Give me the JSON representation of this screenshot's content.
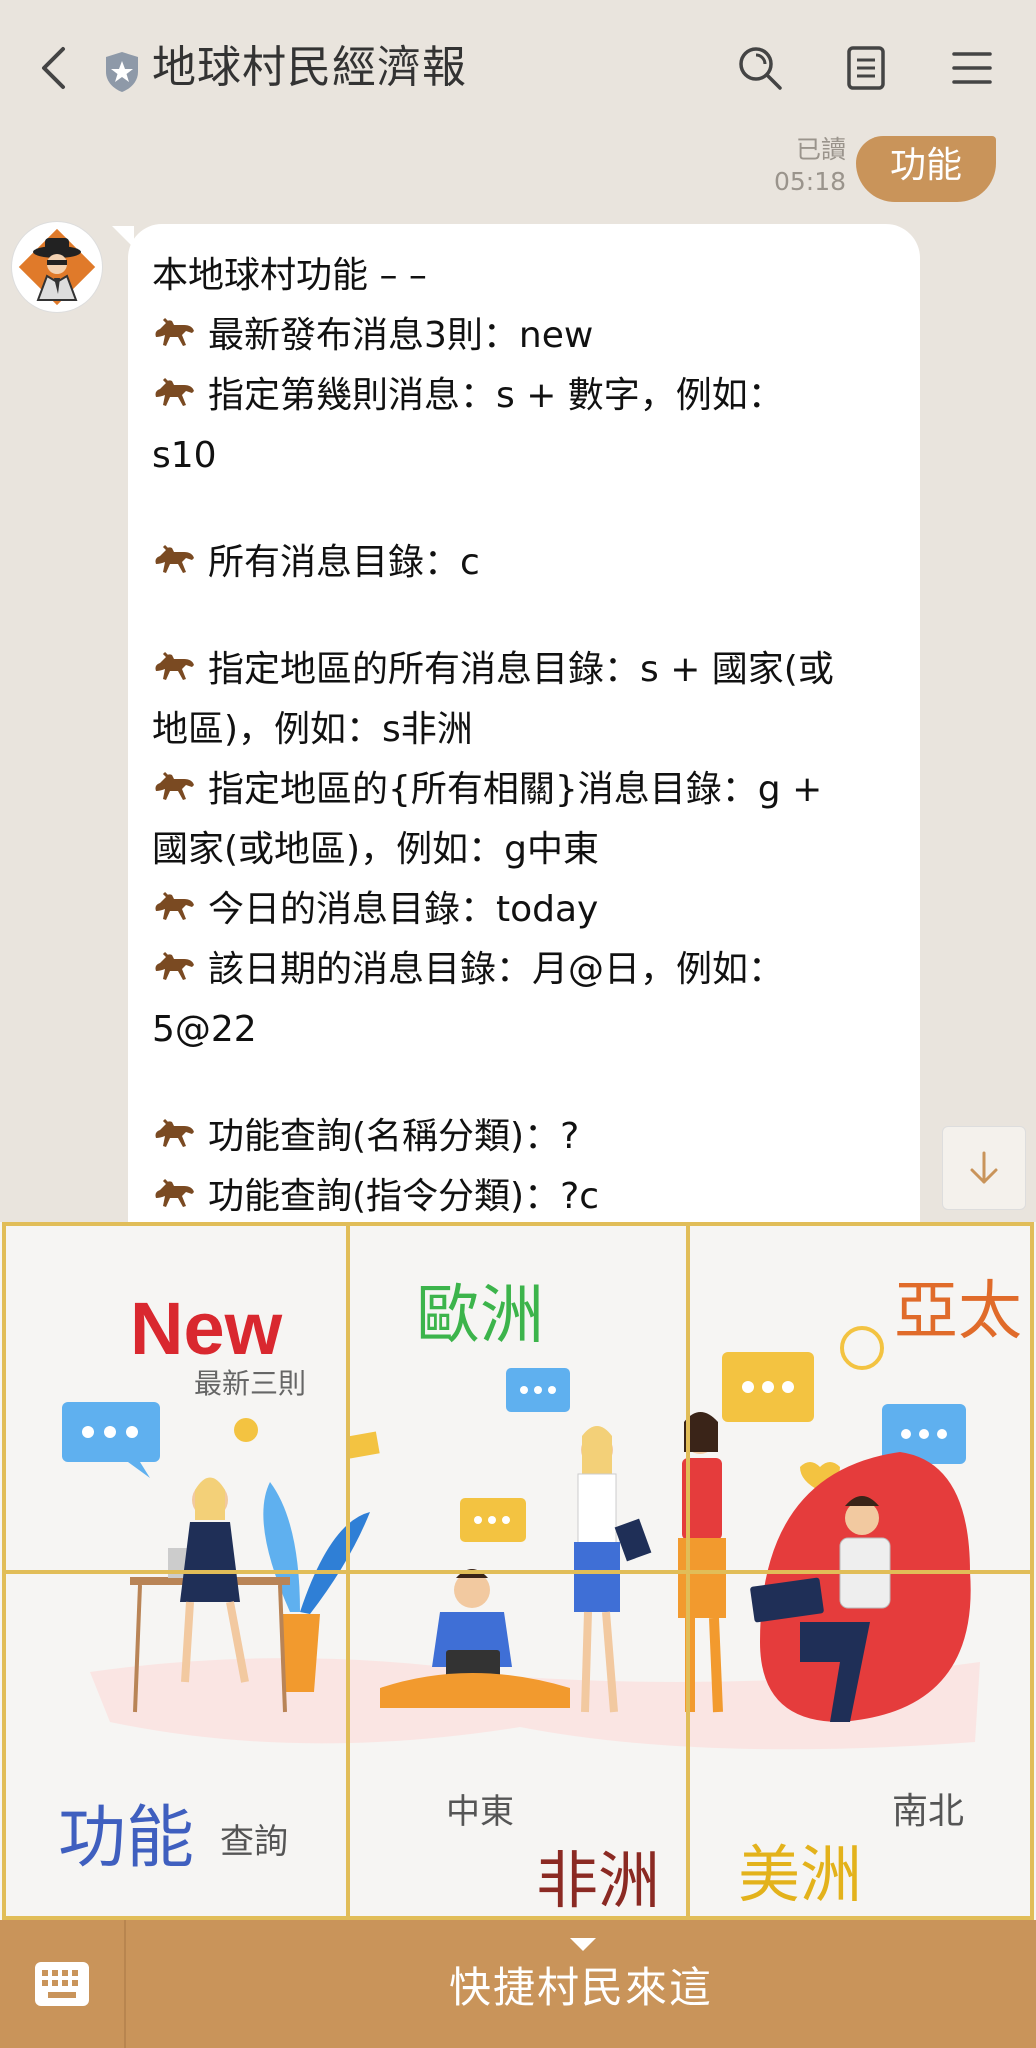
{
  "header": {
    "title": "地球村民經濟報"
  },
  "sent": {
    "read_label": "已讀",
    "time": "05:18",
    "text": "功能"
  },
  "message": {
    "lines": [
      {
        "horse": false,
        "text": "本地球村功能 – –"
      },
      {
        "horse": true,
        "text": "最新發布消息3則：new"
      },
      {
        "horse": true,
        "text": "指定第幾則消息：s + 數字，例如："
      },
      {
        "horse": false,
        "text": "s10"
      },
      {
        "horse": false,
        "text": ""
      },
      {
        "horse": true,
        "text": "所有消息目錄：c"
      },
      {
        "horse": false,
        "text": ""
      },
      {
        "horse": true,
        "text": "指定地區的所有消息目錄：s + 國家(或"
      },
      {
        "horse": false,
        "text": "地區)，例如：s非洲"
      },
      {
        "horse": true,
        "text": "指定地區的{所有相關}消息目錄：g +"
      },
      {
        "horse": false,
        "text": "國家(或地區)，例如：g中東"
      },
      {
        "horse": true,
        "text": "今日的消息目錄：today"
      },
      {
        "horse": true,
        "text": "該日期的消息目錄：月@日，例如："
      },
      {
        "horse": false,
        "text": "5@22"
      },
      {
        "horse": false,
        "text": ""
      },
      {
        "horse": true,
        "text": "功能查詢(名稱分類)：?"
      },
      {
        "horse": true,
        "text": "功能查詢(指令分類)：?c"
      }
    ]
  },
  "richmenu": {
    "new_title": "New",
    "new_sub": "最新三則",
    "europe": "歐洲",
    "asia_pacific": "亞太",
    "function_title": "功能",
    "function_sub": "查詢",
    "middle_east": "中東",
    "africa": "非洲",
    "north_south": "南北",
    "americas": "美洲",
    "colors": {
      "new": "#d9282f",
      "europe": "#3cb44b",
      "asia_pacific": "#e06b2a",
      "function": "#3f5fbf",
      "africa": "#8b2a23",
      "americas": "#e3b21b",
      "border": "#e1bd58"
    }
  },
  "bottom_bar": {
    "label": "快捷村民來這"
  }
}
